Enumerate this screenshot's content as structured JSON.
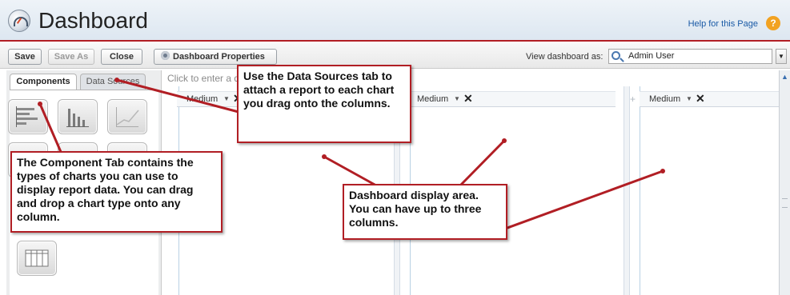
{
  "header": {
    "title": "Dashboard",
    "help_link": "Help for this Page",
    "help_icon": "?"
  },
  "toolbar": {
    "save_label": "Save",
    "save_as_label": "Save As",
    "close_label": "Close",
    "properties_label": "Dashboard Properties",
    "view_as_label": "View dashboard as:",
    "view_as_value": "Admin User"
  },
  "left_panel": {
    "tabs": [
      {
        "label": "Components"
      },
      {
        "label": "Data Sources"
      }
    ]
  },
  "main": {
    "title_placeholder": "Click to enter a d",
    "columns": [
      {
        "size": "Medium"
      },
      {
        "size": "Medium"
      },
      {
        "size": "Medium"
      }
    ]
  },
  "callouts": {
    "data_sources": "Use the Data Sources tab to attach a report to each chart you drag onto the columns.",
    "components": "The Component Tab contains the types of charts you can use to display report data. You can drag and drop a chart type onto any column.",
    "display_area": "Dashboard display area. You can have up to three columns."
  },
  "colors": {
    "accent_red": "#b11e24",
    "help_orange": "#f2a221",
    "link_blue": "#1a5aa6"
  }
}
